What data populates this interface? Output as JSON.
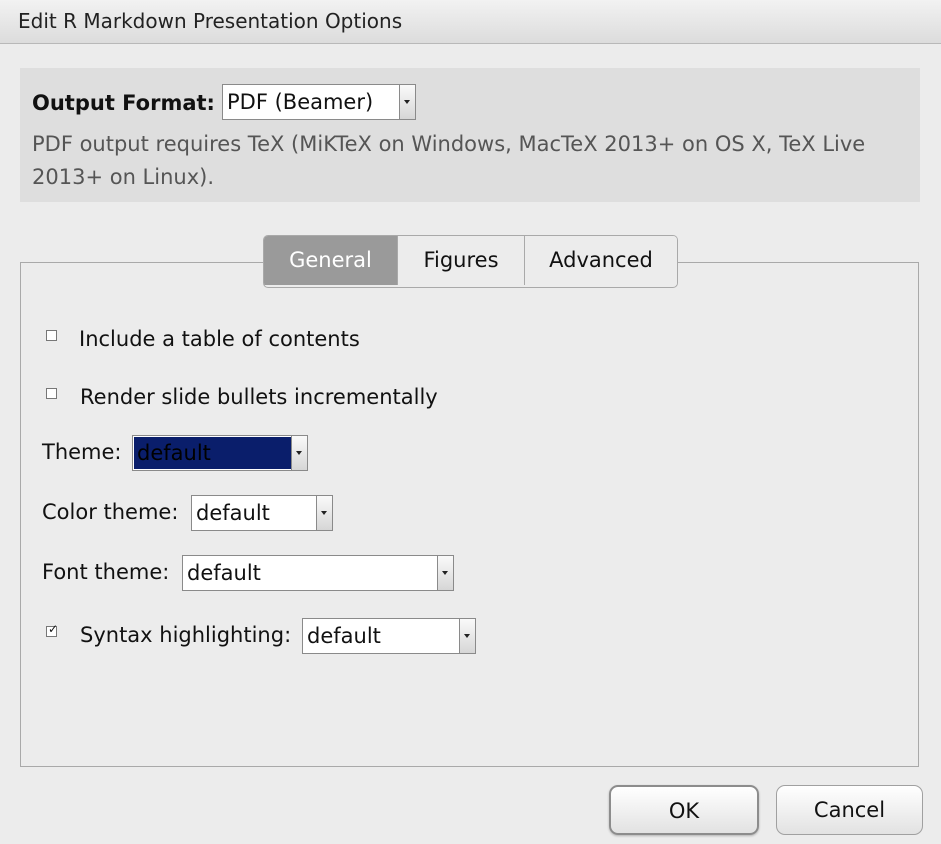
{
  "window": {
    "title": "Edit R Markdown Presentation Options"
  },
  "output_format": {
    "label": "Output Format:",
    "selected": "PDF (Beamer)",
    "note": "PDF output requires TeX (MiKTeX on Windows, MacTeX 2013+ on OS X, TeX Live 2013+ on Linux)."
  },
  "tabs": [
    {
      "label": "General",
      "active": true
    },
    {
      "label": "Figures",
      "active": false
    },
    {
      "label": "Advanced",
      "active": false
    }
  ],
  "general": {
    "toc": {
      "label": "Include a table of contents",
      "checked": false
    },
    "incremental": {
      "label": "Render slide bullets incrementally",
      "checked": false
    },
    "theme": {
      "label": "Theme:",
      "selected": "default"
    },
    "color_theme": {
      "label": "Color theme:",
      "selected": "default"
    },
    "font_theme": {
      "label": "Font theme:",
      "selected": "default"
    },
    "syntax": {
      "label": "Syntax highlighting:",
      "selected": "default",
      "checked": true
    }
  },
  "buttons": {
    "ok": "OK",
    "cancel": "Cancel"
  },
  "colors": {
    "selection": "#0a1e6b",
    "active_tab": "#9a9a9a",
    "panel": "#dedede"
  }
}
